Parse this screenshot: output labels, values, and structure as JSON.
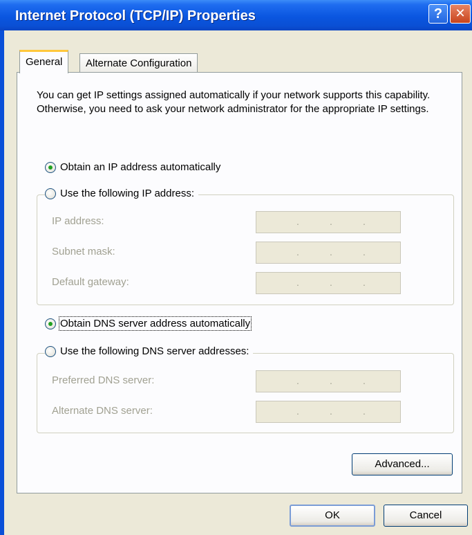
{
  "window": {
    "title": "Internet Protocol (TCP/IP) Properties",
    "help_button": "?",
    "close_button": "✕"
  },
  "tabs": [
    {
      "label": "General",
      "selected": true
    },
    {
      "label": "Alternate Configuration",
      "selected": false
    }
  ],
  "intro_text": "You can get IP settings assigned automatically if your network supports this capability. Otherwise, you need to ask your network administrator for the appropriate IP settings.",
  "ip_section": {
    "obtain_auto_label": "Obtain an IP address automatically",
    "use_following_label": "Use the following IP address:",
    "selected": "obtain_auto",
    "fields": [
      {
        "label": "IP address:",
        "value": "   .   .   ."
      },
      {
        "label": "Subnet mask:",
        "value": "   .   .   ."
      },
      {
        "label": "Default gateway:",
        "value": "   .   .   ."
      }
    ]
  },
  "dns_section": {
    "obtain_auto_label": "Obtain DNS server address automatically",
    "use_following_label": "Use the following DNS server addresses:",
    "selected": "obtain_auto",
    "fields": [
      {
        "label": "Preferred DNS server:",
        "value": "   .   .   ."
      },
      {
        "label": "Alternate DNS server:",
        "value": "   .   .   ."
      }
    ]
  },
  "buttons": {
    "advanced": "Advanced...",
    "ok": "OK",
    "cancel": "Cancel"
  },
  "colors": {
    "titlebar": "#0a56e0",
    "dialog_bg": "#ece9d8",
    "panel_bg": "#fcfcfe",
    "disabled_text": "#a1a192",
    "radio_dot": "#21a121"
  }
}
